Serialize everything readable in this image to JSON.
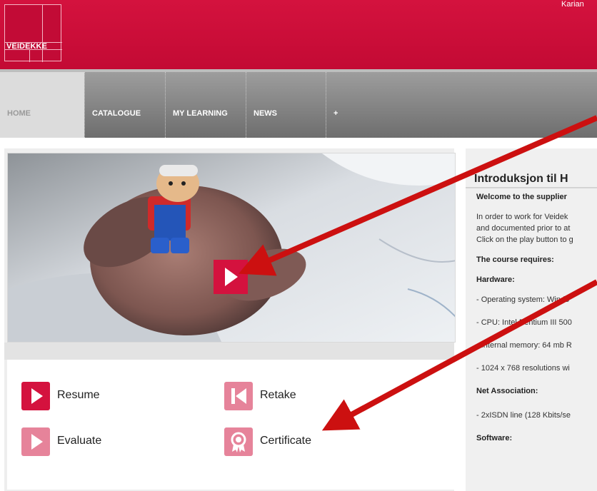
{
  "header": {
    "user_name": "Karian",
    "logo_text": "VEIDEKKE",
    "brand_color": "#c8103a"
  },
  "nav": {
    "items": [
      {
        "label": "HOME"
      },
      {
        "label": "CATALOGUE"
      },
      {
        "label": "MY LEARNING"
      },
      {
        "label": "NEWS"
      },
      {
        "label": "+"
      }
    ]
  },
  "video": {
    "play_icon": "play-icon"
  },
  "actions": {
    "resume": {
      "label": "Resume",
      "icon": "play-icon",
      "color": "#d4123e"
    },
    "retake": {
      "label": "Retake",
      "icon": "skip-back-icon",
      "color": "#e6839a"
    },
    "evaluate": {
      "label": "Evaluate",
      "icon": "play-icon",
      "color": "#e6839a"
    },
    "certificate": {
      "label": "Certificate",
      "icon": "award-ribbon-icon",
      "color": "#e6839a"
    }
  },
  "course": {
    "title": "Introduksjon til H",
    "welcome": "Welcome to the supplier",
    "intro_line1": "In order to work for Veidek",
    "intro_line2": "and documented prior to at",
    "intro_line3": "Click on the play button to g",
    "requires_heading": "The course requires:",
    "hardware_heading": "Hardware:",
    "hw_os": "- Operating system: Windo",
    "hw_cpu": "- CPU: Intel Pentium III 500",
    "hw_memory": "- Internal memory: 64 mb R",
    "hw_resolution": "- 1024 x 768 resolutions wi",
    "net_heading": "Net Association:",
    "net_line": "- 2xISDN line (128 Kbits/se",
    "software_heading": "Software:"
  }
}
